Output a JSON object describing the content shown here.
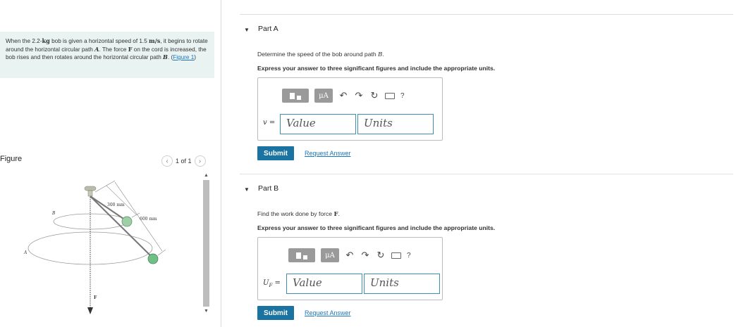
{
  "problem": {
    "text_1": "When the 2.2-",
    "unit_kg": "kg",
    "text_2": " bob is given a horizontal speed of 1.5 ",
    "unit_ms": "m/s",
    "text_3": ", it begins to rotate around the horizontal circular path ",
    "path_a": "A",
    "text_4": ". The force ",
    "force_f": "F",
    "text_5": " on the cord is increased, the bob rises and then rotates around the horizontal circular path ",
    "path_b": "B",
    "text_6": ". (",
    "figure_link": "Figure 1",
    "text_7": ")"
  },
  "figure_panel": {
    "title": "Figure",
    "pager": "1 of 1",
    "prev_icon": "chevron-left-icon",
    "next_icon": "chevron-right-icon",
    "label_300": "300 mm",
    "label_600": "600 mm",
    "label_a": "A",
    "label_b": "B",
    "label_f": "F"
  },
  "part_a": {
    "label": "Part A",
    "prompt_text": "Determine the speed of the bob around path ",
    "prompt_path": "B",
    "prompt_end": ".",
    "instruction": "Express your answer to three significant figures and include the appropriate units.",
    "var_label": "v =",
    "value_placeholder": "Value",
    "units_placeholder": "Units",
    "submit": "Submit",
    "request": "Request Answer",
    "toolbar_mu": "μA",
    "toolbar_help": "?"
  },
  "part_b": {
    "label": "Part B",
    "prompt_text": "Find the work done by force ",
    "prompt_force": "F",
    "prompt_end": ".",
    "instruction": "Express your answer to three significant figures and include the appropriate units.",
    "var_label": "U",
    "var_sub": "F",
    "var_eq": " =",
    "value_placeholder": "Value",
    "units_placeholder": "Units",
    "submit": "Submit",
    "request": "Request Answer",
    "toolbar_mu": "μA",
    "toolbar_help": "?"
  },
  "icons": {
    "undo": "undo-icon",
    "redo": "redo-icon",
    "reset": "reset-icon",
    "keyboard": "keyboard-icon",
    "help": "help-icon",
    "collapse": "triangle-down-icon"
  },
  "colors": {
    "problem_bg": "#e9f3f1",
    "submit_bg": "#1a73a0",
    "link": "#1b75bb",
    "input_border": "#3f8fb3"
  }
}
